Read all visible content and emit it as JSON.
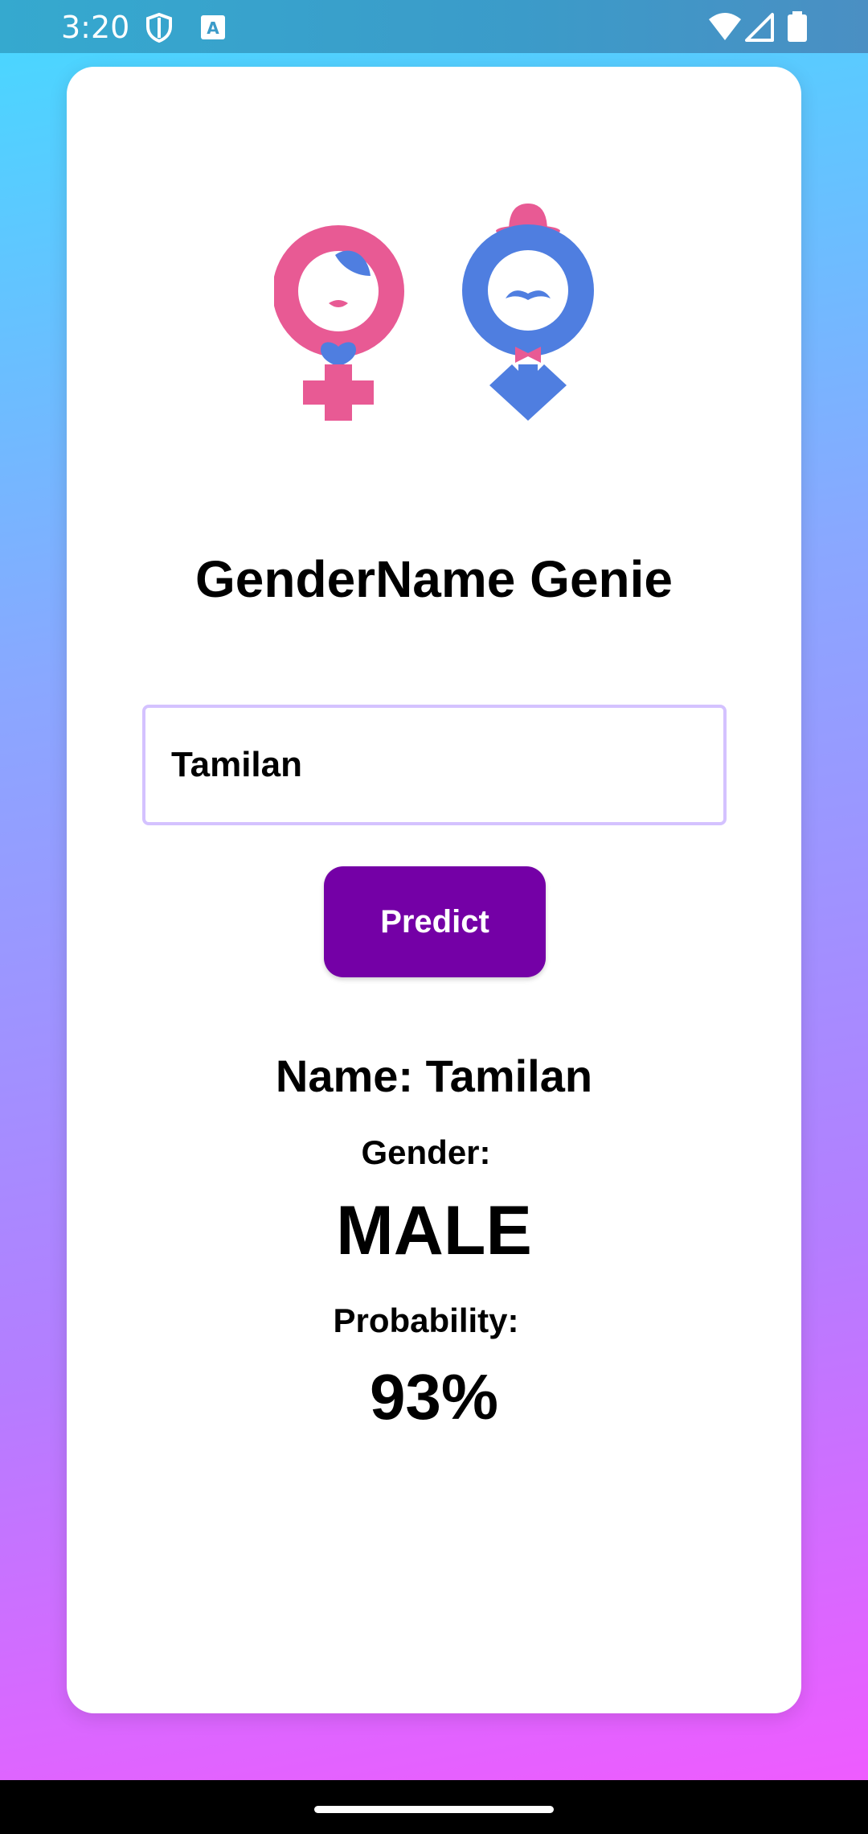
{
  "status_bar": {
    "time": "3:20",
    "icons": [
      "shield-icon",
      "accessibility-a-icon",
      "wifi-icon",
      "signal-icon",
      "battery-icon"
    ]
  },
  "app": {
    "title": "GenderName Genie",
    "logo_icon": "gender-symbols-logo-icon"
  },
  "form": {
    "name_value": "Tamilan",
    "predict_label": "Predict"
  },
  "result": {
    "name_prefix": "Name: ",
    "name": "Tamilan",
    "gender_label": "Gender:",
    "gender": "MALE",
    "probability_label": "Probability:",
    "probability": "93%"
  },
  "colors": {
    "female_pink": "#e85a94",
    "male_blue": "#4f7ee0",
    "button_purple": "#7400a6",
    "input_border": "#d4c2ff"
  }
}
